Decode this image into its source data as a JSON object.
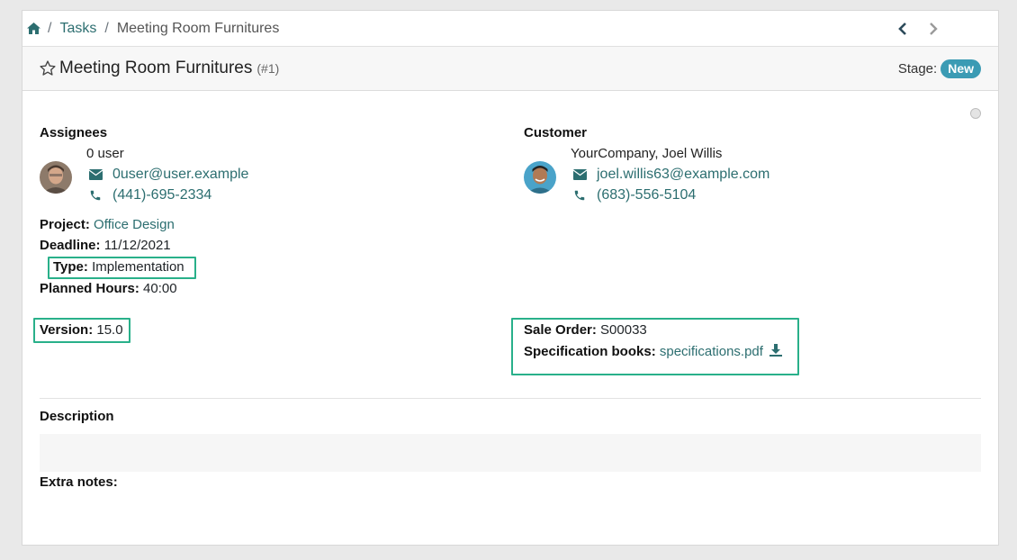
{
  "breadcrumb": {
    "home_icon": "home-icon",
    "sep": "/",
    "tasks": "Tasks",
    "current": "Meeting Room Furnitures"
  },
  "pager": {
    "prev_icon": "chevron-left-icon",
    "next_icon": "chevron-right-icon"
  },
  "title": {
    "star_icon": "star-outline-icon",
    "text": "Meeting Room Furnitures",
    "number": "(#1)"
  },
  "stage": {
    "label": "Stage:",
    "value": "New",
    "color": "#3b9bb4"
  },
  "assignees": {
    "label": "Assignees",
    "name": "0 user",
    "email": "0user@user.example",
    "phone": "(441)-695-2334"
  },
  "customer": {
    "label": "Customer",
    "name": "YourCompany, Joel Willis",
    "email": "joel.willis63@example.com",
    "phone": "(683)-556-5104"
  },
  "fields": {
    "project_label": "Project:",
    "project_value": "Office Design",
    "deadline_label": "Deadline:",
    "deadline_value": "11/12/2021",
    "type_label": "Type:",
    "type_value": "Implementation",
    "planned_label": "Planned Hours:",
    "planned_value": "40:00",
    "version_label": "Version:",
    "version_value": "15.0",
    "sale_order_label": "Sale Order:",
    "sale_order_value": "S00033",
    "spec_label": "Specification books:",
    "spec_value": "specifications.pdf"
  },
  "description": {
    "label": "Description",
    "extra_notes_label": "Extra notes:"
  },
  "colors": {
    "link": "#2c6e70",
    "highlight": "#29b08a"
  }
}
